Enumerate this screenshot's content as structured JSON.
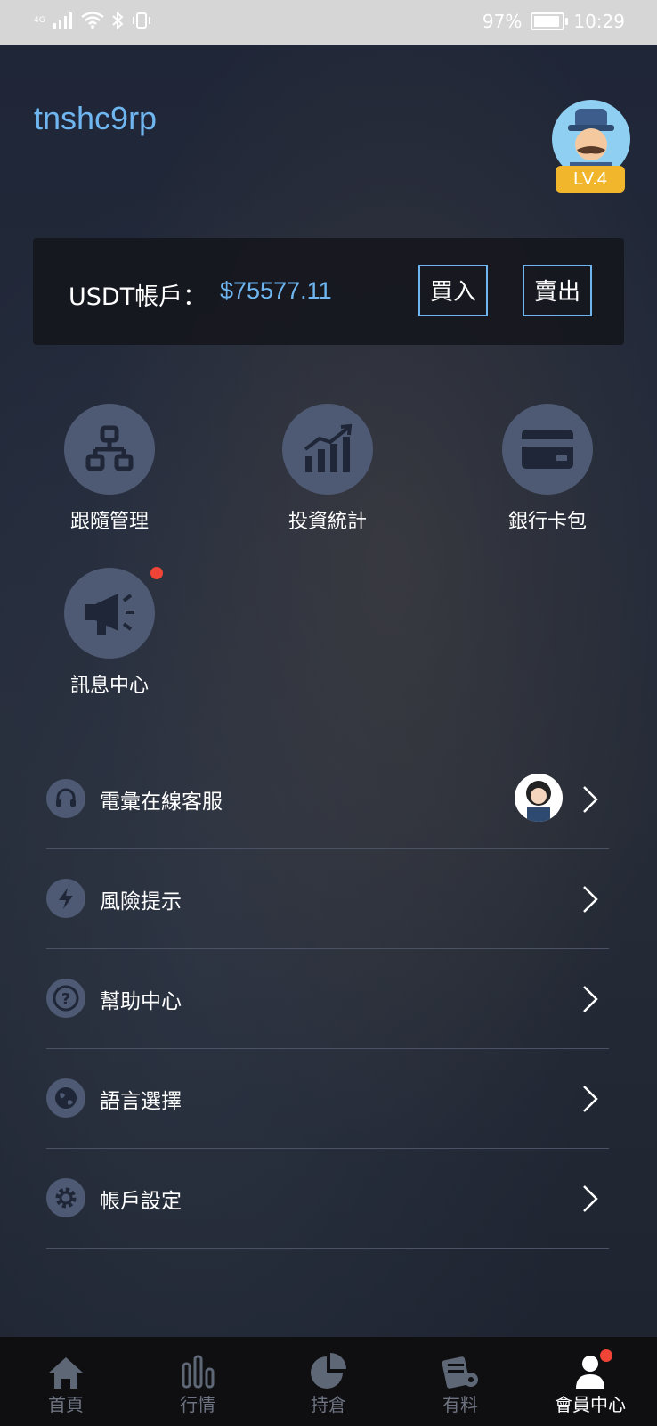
{
  "status_bar": {
    "network": "4G",
    "battery_percent": "97%",
    "time": "10:29"
  },
  "header": {
    "username": "tnshc9rp",
    "level_badge": "LV.4"
  },
  "account": {
    "label": "USDT帳戶：",
    "value": "$75577.11",
    "buy_label": "買入",
    "sell_label": "賣出"
  },
  "grid": {
    "items": [
      {
        "label": "跟隨管理",
        "icon": "org-chart-icon"
      },
      {
        "label": "投資統計",
        "icon": "bar-chart-icon"
      },
      {
        "label": "銀行卡包",
        "icon": "credit-card-icon"
      },
      {
        "label": "訊息中心",
        "icon": "megaphone-icon",
        "has_notification": true
      }
    ]
  },
  "menu": {
    "items": [
      {
        "label": "電彙在線客服",
        "icon": "headset-icon"
      },
      {
        "label": "風險提示",
        "icon": "lightning-icon"
      },
      {
        "label": "幫助中心",
        "icon": "question-icon"
      },
      {
        "label": "語言選擇",
        "icon": "globe-icon"
      },
      {
        "label": "帳戶設定",
        "icon": "gear-icon"
      }
    ]
  },
  "tabbar": {
    "tabs": [
      {
        "label": "首頁",
        "icon": "home-icon"
      },
      {
        "label": "行情",
        "icon": "chart-bars-icon"
      },
      {
        "label": "持倉",
        "icon": "pie-icon"
      },
      {
        "label": "有料",
        "icon": "docs-gear-icon"
      },
      {
        "label": "會員中心",
        "icon": "user-icon",
        "active": true
      }
    ]
  },
  "colors": {
    "accent": "#6fb6f0",
    "badge": "#f2b62c",
    "notification": "#f04436",
    "icon_circle": "#4e5a73"
  }
}
